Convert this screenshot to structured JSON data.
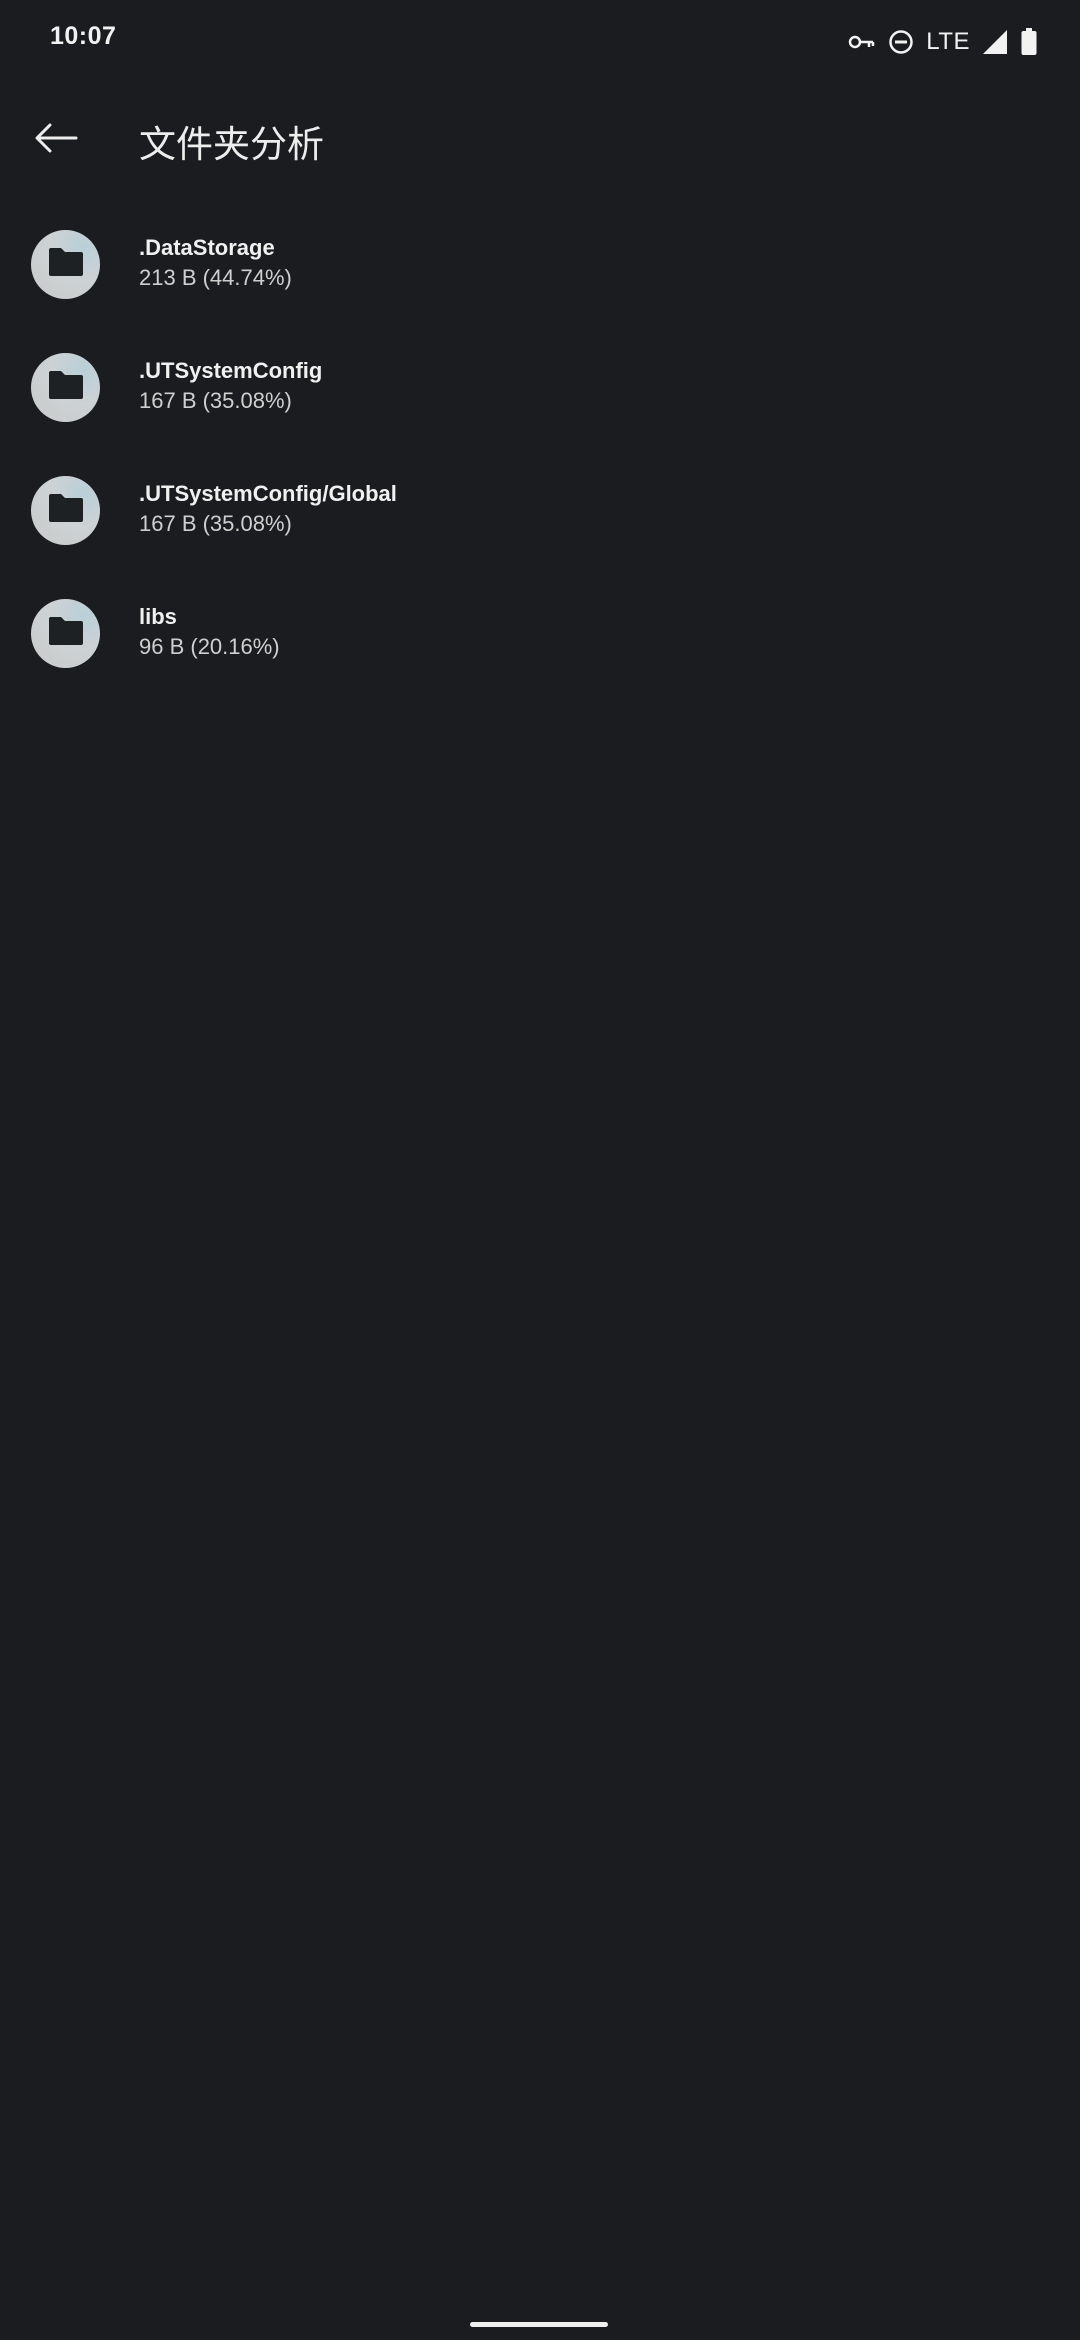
{
  "status_bar": {
    "time": "10:07",
    "network": "LTE",
    "icons": [
      "vpn-key-icon",
      "do-not-disturb-icon",
      "signal-icon",
      "battery-icon"
    ]
  },
  "app_bar": {
    "title": "文件夹分析",
    "back_icon": "arrow-back-icon"
  },
  "folders": [
    {
      "name": ".DataStorage",
      "size": "213 B (44.74%)"
    },
    {
      "name": ".UTSystemConfig",
      "size": "167 B (35.08%)"
    },
    {
      "name": ".UTSystemConfig/Global",
      "size": "167 B (35.08%)"
    },
    {
      "name": "libs",
      "size": "96 B (20.16%)"
    }
  ],
  "colors": {
    "background": "#1a1c1f",
    "avatar": "#c9c9c9",
    "folder_glyph": "#1e2124"
  }
}
